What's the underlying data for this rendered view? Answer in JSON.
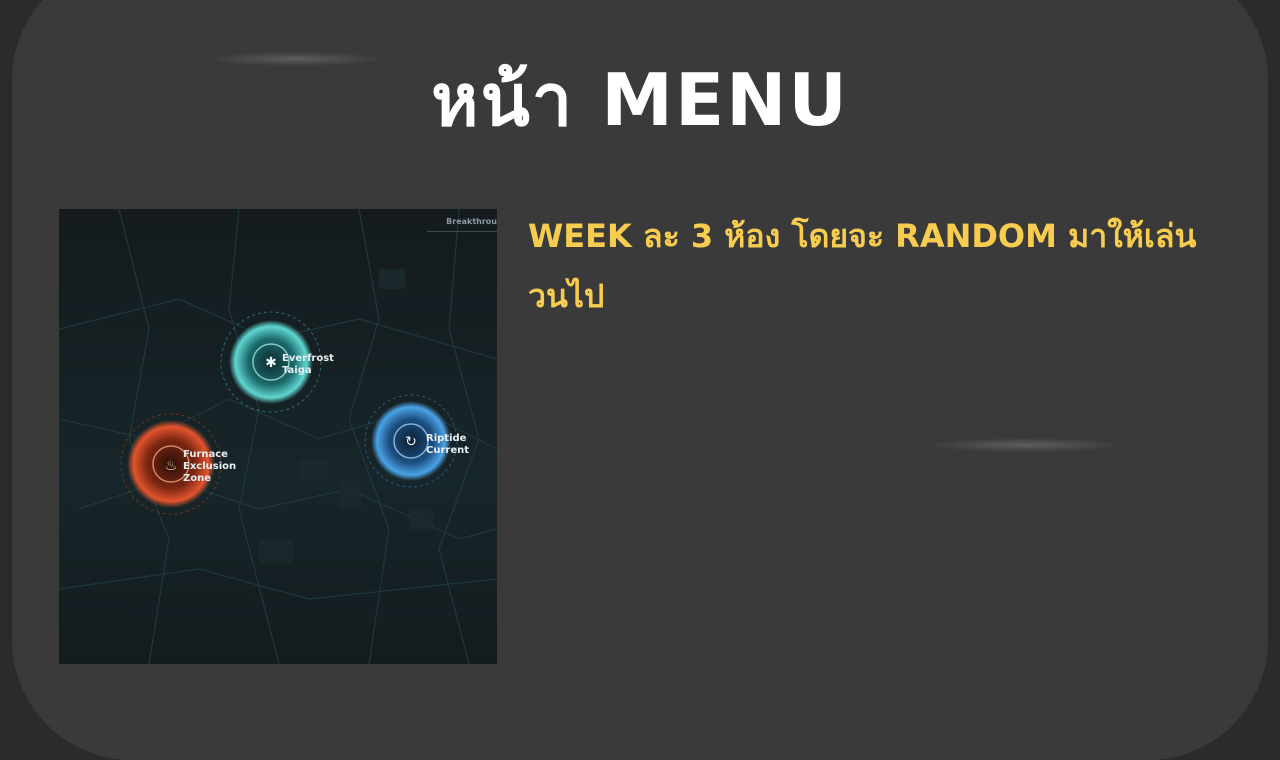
{
  "slide": {
    "title": "หน้า MENU",
    "description": "WEEK ละ 3 ห้อง โดยจะ RANDOM มาให้เล่น วนไป"
  },
  "screenshot": {
    "header": "Breakthrou",
    "nodes": [
      {
        "name": "everfrost",
        "line1": "Everfrost",
        "line2": "Taiga",
        "line3": "",
        "icon": "snowflake-icon",
        "color": "#5fd6d0"
      },
      {
        "name": "riptide",
        "line1": "Riptide",
        "line2": "Current",
        "line3": "",
        "icon": "wave-icon",
        "color": "#4aa3e6"
      },
      {
        "name": "furnace",
        "line1": "Furnace",
        "line2": "Exclusion",
        "line3": "Zone",
        "icon": "flame-icon",
        "color": "#e2542d"
      }
    ]
  },
  "colors": {
    "background": "#3a3a3a",
    "title": "#ffffff",
    "description": "#f7cc4f"
  }
}
